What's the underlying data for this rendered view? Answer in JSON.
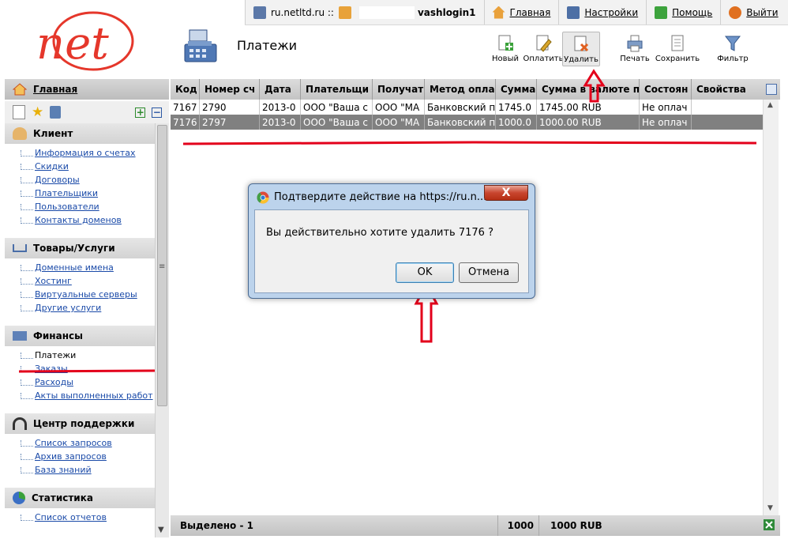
{
  "topbar": {
    "domain": "ru.netltd.ru ::",
    "login": "vashlogin1",
    "home": "Главная",
    "settings": "Настройки",
    "help": "Помощь",
    "logout": "Выйти"
  },
  "logo": {
    "text": "net"
  },
  "page": {
    "title": "Платежи"
  },
  "toolbar": {
    "new": "Новый",
    "pay": "Оплатить",
    "delete": "Удалить",
    "print": "Печать",
    "save": "Сохранить",
    "filter": "Фильтр"
  },
  "sidebar": {
    "home": "Главная",
    "sections": [
      {
        "title": "Клиент",
        "items": [
          "Информация о счетах",
          "Скидки",
          "Договоры",
          "Плательщики",
          "Пользователи",
          "Контакты доменов"
        ]
      },
      {
        "title": "Товары/Услуги",
        "items": [
          "Доменные имена",
          "Хостинг",
          "Виртуальные серверы",
          "Другие услуги"
        ]
      },
      {
        "title": "Финансы",
        "items": [
          "Платежи",
          "Заказы",
          "Расходы",
          "Акты выполненных работ"
        ]
      },
      {
        "title": "Центр поддержки",
        "items": [
          "Список запросов",
          "Архив запросов",
          "База знаний"
        ]
      },
      {
        "title": "Статистика",
        "items": [
          "Список отчетов"
        ]
      }
    ]
  },
  "grid": {
    "columns": [
      "Код",
      "Номер сч",
      "Дата",
      "Плательщи",
      "Получат",
      "Метод опла",
      "Сумма",
      "Сумма в валюте п",
      "Состоян",
      "Свойства"
    ],
    "rows": [
      [
        "7167",
        "2790",
        "2013-0",
        "ООО \"Ваша с",
        "ООО \"МА",
        "Банковский п",
        "1745.0",
        "1745.00 RUB",
        "Не оплач",
        ""
      ],
      [
        "7176",
        "2797",
        "2013-0",
        "ООО \"Ваша с",
        "ООО \"МА",
        "Банковский п",
        "1000.0",
        "1000.00 RUB",
        "Не оплач",
        ""
      ]
    ],
    "selected_row": 1
  },
  "footer": {
    "selected": "Выделено - 1",
    "sum": "1000",
    "sum_currency": "1000 RUB"
  },
  "dialog": {
    "title": "Подтвердите действие на https://ru.n...",
    "close": "X",
    "message": "Вы действительно хотите удалить  7176 ?",
    "ok": "OK",
    "cancel": "Отмена"
  },
  "colors": {
    "annotation": "#e3001b",
    "selected_row": "#808080",
    "link": "#1a4aa8",
    "logo": "#e5372b"
  }
}
